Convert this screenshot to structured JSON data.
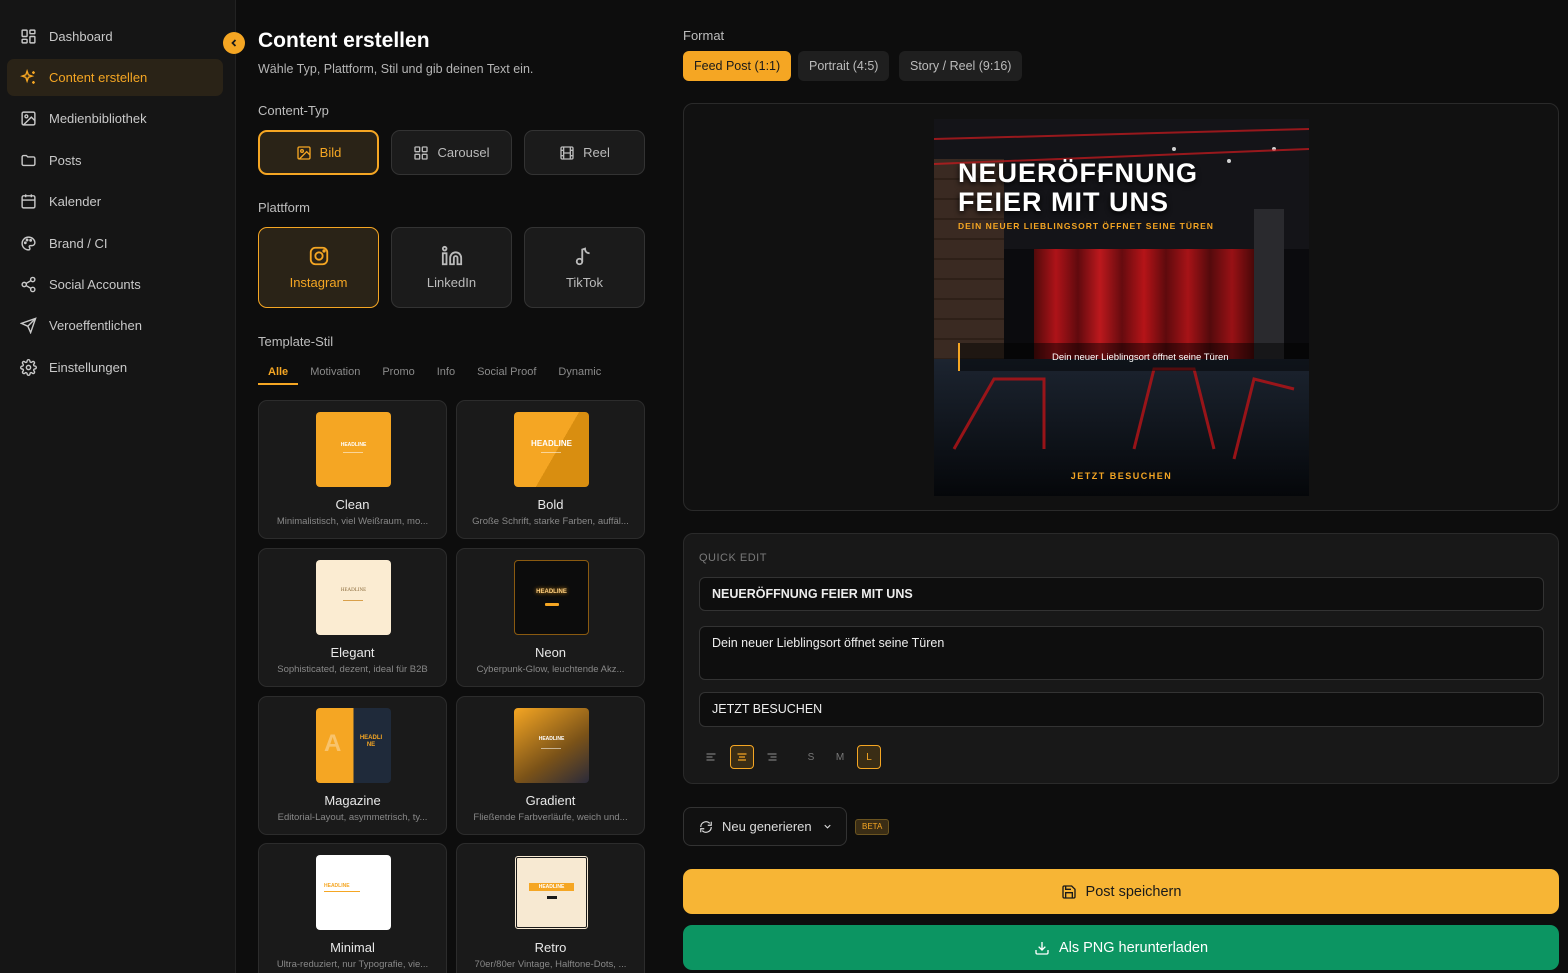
{
  "sidebar": {
    "items": [
      {
        "label": "Dashboard",
        "icon": "grid-icon"
      },
      {
        "label": "Content erstellen",
        "icon": "sparkle-icon",
        "active": true
      },
      {
        "label": "Medienbibliothek",
        "icon": "image-icon"
      },
      {
        "label": "Posts",
        "icon": "folder-icon"
      },
      {
        "label": "Kalender",
        "icon": "calendar-icon"
      },
      {
        "label": "Brand / CI",
        "icon": "palette-icon"
      },
      {
        "label": "Social Accounts",
        "icon": "share-icon"
      },
      {
        "label": "Veroeffentlichen",
        "icon": "send-icon"
      },
      {
        "label": "Einstellungen",
        "icon": "gear-icon"
      }
    ]
  },
  "page": {
    "title": "Content erstellen",
    "subtitle": "Wähle Typ, Plattform, Stil und gib deinen Text ein."
  },
  "content_type": {
    "label": "Content-Typ",
    "options": [
      "Bild",
      "Carousel",
      "Reel"
    ],
    "selected": "Bild"
  },
  "platform": {
    "label": "Plattform",
    "options": [
      "Instagram",
      "LinkedIn",
      "TikTok"
    ],
    "selected": "Instagram"
  },
  "template_style": {
    "label": "Template-Stil",
    "tabs": [
      "Alle",
      "Motivation",
      "Promo",
      "Info",
      "Social Proof",
      "Dynamic"
    ],
    "selected_tab": "Alle",
    "templates": [
      {
        "name": "Clean",
        "desc": "Minimalistisch, viel Weißraum, mo...",
        "thumb_text": "HEADLINE"
      },
      {
        "name": "Bold",
        "desc": "Große Schrift, starke Farben, auffäl...",
        "thumb_text": "HEADLINE"
      },
      {
        "name": "Elegant",
        "desc": "Sophisticated, dezent, ideal für B2B",
        "thumb_text": "HEADLINE"
      },
      {
        "name": "Neon",
        "desc": "Cyberpunk-Glow, leuchtende Akz...",
        "thumb_text": "HEADLINE"
      },
      {
        "name": "Magazine",
        "desc": "Editorial-Layout, asymmetrisch, ty...",
        "thumb_text": "HEADLI NE"
      },
      {
        "name": "Gradient",
        "desc": "Fließende Farbverläufe, weich und...",
        "thumb_text": "HEADLINE"
      },
      {
        "name": "Minimal",
        "desc": "Ultra-reduziert, nur Typografie, vie...",
        "thumb_text": "HEADLINE"
      },
      {
        "name": "Retro",
        "desc": "70er/80er Vintage, Halftone-Dots, ...",
        "thumb_text": "HEADLINE"
      }
    ]
  },
  "format": {
    "label": "Format",
    "options": [
      "Feed Post (1:1)",
      "Portrait (4:5)",
      "Story / Reel (9:16)"
    ],
    "selected": "Feed Post (1:1)"
  },
  "preview": {
    "headline_line1": "NEUERÖFFNUNG",
    "headline_line2": "FEIER MIT UNS",
    "tagline": "DEIN NEUER LIEBLINGSORT ÖFFNET SEINE TÜREN",
    "body": "Dein neuer Lieblingsort öffnet seine Türen",
    "cta": "JETZT BESUCHEN"
  },
  "quick_edit": {
    "label": "QUICK EDIT",
    "headline": "NEUERÖFFNUNG FEIER MIT UNS",
    "body": "Dein neuer Lieblingsort öffnet seine Türen",
    "cta": "JETZT BESUCHEN",
    "sizes": [
      "S",
      "M",
      "L"
    ],
    "selected_size": "L",
    "selected_align": "center"
  },
  "actions": {
    "regenerate": "Neu generieren",
    "beta": "BETA",
    "save": "Post speichern",
    "download": "Als PNG herunterladen"
  },
  "colors": {
    "accent": "#f5a623",
    "save": "#f7b535",
    "download": "#0c9562"
  }
}
